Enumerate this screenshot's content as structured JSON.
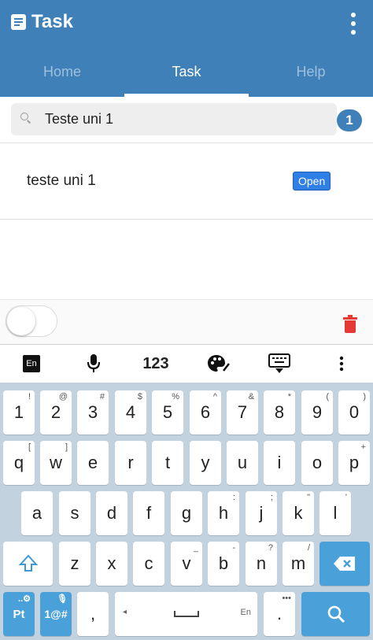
{
  "appbar": {
    "title": "Task",
    "tabs": [
      {
        "label": "Home",
        "active": false
      },
      {
        "label": "Task",
        "active": true
      },
      {
        "label": "Help",
        "active": false
      }
    ],
    "colors": {
      "primary": "#3f80b8"
    }
  },
  "search": {
    "value": "Teste uni 1",
    "result_count": "1"
  },
  "tasks": [
    {
      "name": "teste uni 1",
      "status": "Open"
    }
  ],
  "controls": {
    "toggle_on": false,
    "delete_icon": "trash-icon",
    "delete_color": "#e53935"
  },
  "keyboard": {
    "toolbar": {
      "language": "En",
      "numbers_label": "123",
      "icons": [
        "mic-icon",
        "palette-icon",
        "hide-keyboard-icon",
        "more-vert-icon"
      ]
    },
    "rows": [
      [
        {
          "k": "1",
          "s": "!"
        },
        {
          "k": "2",
          "s": "@"
        },
        {
          "k": "3",
          "s": "#"
        },
        {
          "k": "4",
          "s": "$"
        },
        {
          "k": "5",
          "s": "%"
        },
        {
          "k": "6",
          "s": "^"
        },
        {
          "k": "7",
          "s": "&"
        },
        {
          "k": "8",
          "s": "*"
        },
        {
          "k": "9",
          "s": "("
        },
        {
          "k": "0",
          "s": ")"
        }
      ],
      [
        {
          "k": "q",
          "s": "["
        },
        {
          "k": "w",
          "s": "]"
        },
        {
          "k": "e",
          "s": ""
        },
        {
          "k": "r",
          "s": ""
        },
        {
          "k": "t",
          "s": ""
        },
        {
          "k": "y",
          "s": ""
        },
        {
          "k": "u",
          "s": ""
        },
        {
          "k": "i",
          "s": ""
        },
        {
          "k": "o",
          "s": ""
        },
        {
          "k": "p",
          "s": "+"
        }
      ],
      [
        {
          "k": "a",
          "s": ""
        },
        {
          "k": "s",
          "s": ""
        },
        {
          "k": "d",
          "s": ""
        },
        {
          "k": "f",
          "s": ""
        },
        {
          "k": "g",
          "s": ""
        },
        {
          "k": "h",
          "s": ":"
        },
        {
          "k": "j",
          "s": ";"
        },
        {
          "k": "k",
          "s": "\""
        },
        {
          "k": "l",
          "s": "'"
        }
      ],
      [
        {
          "k": "z",
          "s": ""
        },
        {
          "k": "x",
          "s": ""
        },
        {
          "k": "c",
          "s": ""
        },
        {
          "k": "v",
          "s": "_"
        },
        {
          "k": "b",
          "s": "-"
        },
        {
          "k": "n",
          "s": "?"
        },
        {
          "k": "m",
          "s": "/"
        }
      ]
    ],
    "bottom": {
      "lang_key": "Pt",
      "symbols_key": "1@#",
      "comma": ",",
      "space_hint": "En",
      "period": ".",
      "action_icon": "search-icon"
    },
    "colors": {
      "background": "#c3d2df",
      "accent": "#4aa1d9"
    }
  }
}
